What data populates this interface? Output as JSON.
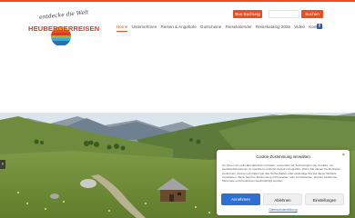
{
  "header": {
    "logo_tagline": "entdecke die Welt",
    "logo_name": "HEUBERGERREISEN",
    "booking_button": "Bus Buchung",
    "search_button": "Suchen",
    "search_placeholder": "",
    "facebook_icon": "facebook-icon"
  },
  "nav": {
    "items": [
      "Home",
      "Unternehmen",
      "Reisen & Angebote",
      "Gutscheine",
      "Reisekalender",
      "Reisekatalog 2025",
      "Video",
      "Kontakt"
    ],
    "active": "Home"
  },
  "hero": {
    "scene": "alpine-meadow-with-hut",
    "prev_arrow": "‹"
  },
  "cookie_banner": {
    "title": "Cookie-Zustimmung verwalten",
    "close": "×",
    "text": "Um Ihnen ein optimales Erlebnis zu bieten, verwenden wir Technologien wie Cookies, um Geräteinformationen zu speichern und/oder darauf zuzugreifen. Wenn Sie diesen Technologien zustimmen, können wir Daten wie das Surfverhalten oder eindeutige IDs auf dieser Website verarbeiten. Wenn Sie Ihre Zustimmung nicht erteilen oder zurückziehen, können bestimmte Merkmale und Funktionen beeinträchtigt werden.",
    "accept": "Annehmen",
    "deny": "Ablehnen",
    "preferences": "Einstellungen",
    "privacy_link": "Datenschutzerklärung"
  },
  "colors": {
    "accent": "#e9501f",
    "cookie_primary": "#2f6ed5"
  }
}
